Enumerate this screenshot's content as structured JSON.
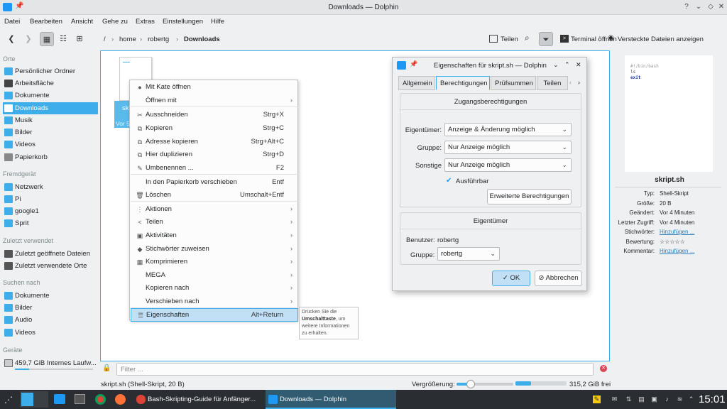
{
  "window": {
    "title": "Downloads — Dolphin",
    "controls": [
      "?",
      "⌄",
      "◇",
      "✕"
    ]
  },
  "menu": [
    "Datei",
    "Bearbeiten",
    "Ansicht",
    "Gehe zu",
    "Extras",
    "Einstellungen",
    "Hilfe"
  ],
  "breadcrumb": {
    "root": "/",
    "parts": [
      "home",
      "robertg",
      "Downloads"
    ],
    "sep": "›"
  },
  "toolbar": {
    "share": "Teilen",
    "terminal": "Terminal öffnen",
    "hidden": "Versteckte Dateien anzeigen"
  },
  "sidebar": {
    "orte_header": "Orte",
    "orte": [
      "Persönlicher Ordner",
      "Arbeitsfläche",
      "Dokumente",
      "Downloads",
      "Musik",
      "Bilder",
      "Videos",
      "Papierkorb"
    ],
    "remote_header": "Fremdgerät",
    "remote": [
      "Netzwerk",
      "Pi",
      "google1",
      "Sprit"
    ],
    "recent_header": "Zuletzt verwendet",
    "recent": [
      "Zuletzt geöffnete Dateien",
      "Zuletzt verwendete Orte"
    ],
    "search_header": "Suchen nach",
    "search": [
      "Dokumente",
      "Bilder",
      "Audio",
      "Videos"
    ],
    "devices_header": "Geräte",
    "devices": [
      "459,7 GiB Internes Laufw..."
    ]
  },
  "file": {
    "label_fragment": "sk",
    "sub_fragment": "Vor 5"
  },
  "context_menu": [
    {
      "icon": "●",
      "label": "Mit Kate öffnen",
      "shortcut": "",
      "arrow": ""
    },
    {
      "icon": "",
      "label": "Öffnen mit",
      "shortcut": "",
      "arrow": "›"
    },
    {
      "icon": "✂",
      "label": "Ausschneiden",
      "shortcut": "Strg+X",
      "arrow": ""
    },
    {
      "icon": "⧉",
      "label": "Kopieren",
      "shortcut": "Strg+C",
      "arrow": ""
    },
    {
      "icon": "⧉",
      "label": "Adresse kopieren",
      "shortcut": "Strg+Alt+C",
      "arrow": ""
    },
    {
      "icon": "⧉",
      "label": "Hier duplizieren",
      "shortcut": "Strg+D",
      "arrow": ""
    },
    {
      "icon": "✎",
      "label": "Umbenennen ...",
      "shortcut": "F2",
      "arrow": ""
    },
    {
      "icon": "",
      "label": "In den Papierkorb verschieben",
      "shortcut": "Entf",
      "arrow": ""
    },
    {
      "icon": "🗑",
      "label": "Löschen",
      "shortcut": "Umschalt+Entf",
      "arrow": ""
    },
    {
      "icon": "⋮",
      "label": "Aktionen",
      "shortcut": "",
      "arrow": "›"
    },
    {
      "icon": "<",
      "label": "Teilen",
      "shortcut": "",
      "arrow": "›"
    },
    {
      "icon": "▣",
      "label": "Aktivitäten",
      "shortcut": "",
      "arrow": "›"
    },
    {
      "icon": "◆",
      "label": "Stichwörter zuweisen",
      "shortcut": "",
      "arrow": "›"
    },
    {
      "icon": "▦",
      "label": "Komprimieren",
      "shortcut": "",
      "arrow": "›"
    },
    {
      "icon": "",
      "label": "MEGA",
      "shortcut": "",
      "arrow": "›"
    },
    {
      "icon": "",
      "label": "Kopieren nach",
      "shortcut": "",
      "arrow": "›"
    },
    {
      "icon": "",
      "label": "Verschieben nach",
      "shortcut": "",
      "arrow": "›"
    },
    {
      "icon": "☰",
      "label": "Eigenschaften",
      "shortcut": "Alt+Return",
      "arrow": ""
    }
  ],
  "tooltip": {
    "line1": "Drücken Sie die",
    "bold": "Umschalttaste",
    "line2": ", um weitere Informationen zu erhalten."
  },
  "dialog": {
    "title": "Eigenschaften für skript.sh — Dolphin",
    "tabs": [
      "Allgemein",
      "Berechtigungen",
      "Prüfsummen",
      "Teilen"
    ],
    "access_title": "Zugangsberechtigungen",
    "owner_label": "Eigentümer:",
    "owner_value": "Anzeige & Änderung möglich",
    "group_label": "Gruppe:",
    "group_value": "Nur Anzeige möglich",
    "others_label": "Sonstige",
    "others_value": "Nur Anzeige möglich",
    "exec_label": "Ausführbar",
    "adv_button": "Erweiterte Berechtigungen",
    "ownership_title": "Eigentümer",
    "user_label": "Benutzer:",
    "user_value": "robertg",
    "grp_label": "Gruppe:",
    "grp_value": "robertg",
    "ok": "OK",
    "cancel": "Abbrechen"
  },
  "info_panel": {
    "preview": [
      "#!/bin/bash",
      "ls",
      "exit"
    ],
    "filename": "skript.sh",
    "rows": [
      {
        "k": "Typ:",
        "v": "Shell-Skript",
        "link": false
      },
      {
        "k": "Größe:",
        "v": "20 B",
        "link": false
      },
      {
        "k": "Geändert:",
        "v": "Vor 4 Minuten",
        "link": false
      },
      {
        "k": "Letzter Zugriff:",
        "v": "Vor 4 Minuten",
        "link": false
      },
      {
        "k": "Stichwörter:",
        "v": "Hinzufügen ...",
        "link": true
      },
      {
        "k": "Bewertung:",
        "v": "☆☆☆☆☆",
        "link": false
      },
      {
        "k": "Kommentar:",
        "v": "Hinzufügen ...",
        "link": true
      }
    ]
  },
  "filter": {
    "placeholder": "Filter ..."
  },
  "status": {
    "text": "skript.sh (Shell-Skript, 20 B)",
    "zoom_label": "Vergrößerung:",
    "zoom_fraction": 0.25,
    "free_space": "315,2 GiB frei",
    "used_fraction": 0.3
  },
  "taskbar": {
    "tasks": [
      "Bash-Skripting-Guide für Anfänger...",
      "Downloads — Dolphin"
    ],
    "clock": "15:01"
  }
}
